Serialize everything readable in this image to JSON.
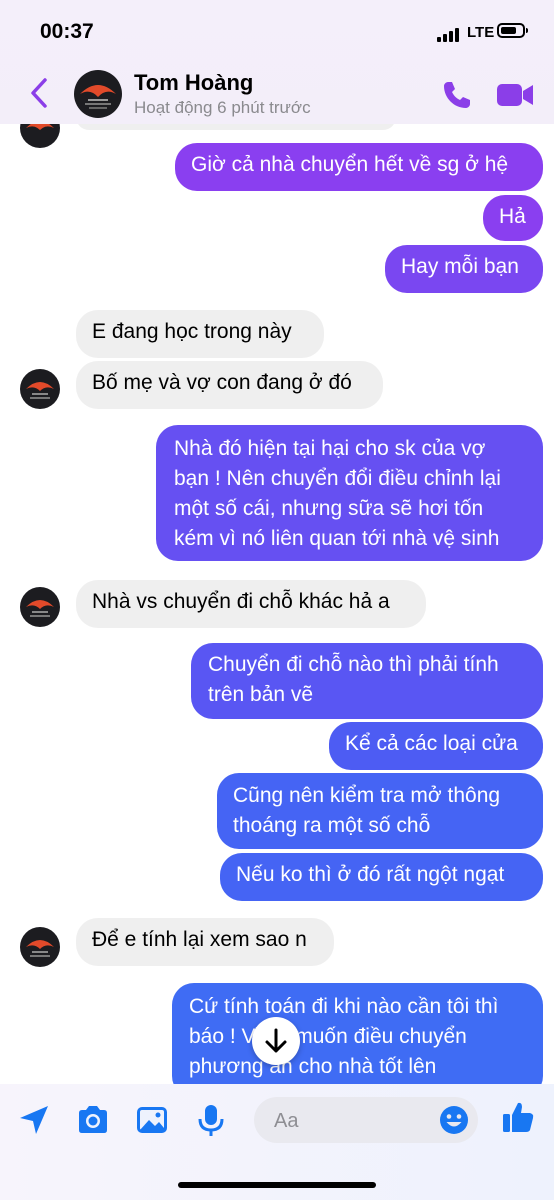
{
  "status_bar": {
    "time": "00:37",
    "network": "LTE",
    "battery_level": 0.75
  },
  "header": {
    "contact_name": "Tom Hoàng",
    "contact_status": "Hoạt động 6 phút trước",
    "icons": {
      "back": "chevron-left-icon",
      "call": "phone-icon",
      "video": "video-camera-icon"
    },
    "accent_color": "#8b3ee8"
  },
  "messages": [
    {
      "from": "me",
      "lines": [
        "Giờ cả nhà chuyển hết về sg ở hệ"
      ]
    },
    {
      "from": "me",
      "lines": [
        "Hả"
      ]
    },
    {
      "from": "me",
      "lines": [
        "Hay mỗi bạn"
      ]
    },
    {
      "from": "them",
      "lines": [
        "E đang học trong này"
      ]
    },
    {
      "from": "them",
      "lines": [
        "Bố mẹ và vợ con đang ở đó"
      ]
    },
    {
      "from": "me",
      "lines": [
        "Nhà đó hiện tại hại cho sk của vợ",
        "bạn ! Nên chuyển đổi điều chỉnh lại",
        "một số cái, nhưng sữa sẽ hơi tốn",
        "kém vì nó liên quan tới nhà vệ sinh"
      ]
    },
    {
      "from": "them",
      "lines": [
        "Nhà vs chuyển đi chỗ khác hả a"
      ]
    },
    {
      "from": "me",
      "lines": [
        "Chuyển đi chỗ nào thì phải tính",
        "trên bản vẽ"
      ]
    },
    {
      "from": "me",
      "lines": [
        "Kể cả các loại cửa"
      ]
    },
    {
      "from": "me",
      "lines": [
        "Cũng nên kiểm tra mở thông",
        "thoáng ra một số chỗ"
      ]
    },
    {
      "from": "me",
      "lines": [
        "Nếu ko thì ở đó rất ngột ngạt"
      ]
    },
    {
      "from": "them",
      "lines": [
        "Để e tính lại xem sao n"
      ]
    },
    {
      "from": "me",
      "lines": [
        "Cứ tính toán đi khi nào cần tôi thì",
        "báo ! Vì tôi muốn điều chuyển",
        "phương án cho nhà tốt lên"
      ]
    }
  ],
  "composer": {
    "placeholder": "Aa",
    "icons": [
      "send-location-icon",
      "camera-icon",
      "gallery-icon",
      "microphone-icon",
      "emoji-icon",
      "thumbs-up-icon"
    ],
    "accent_color": "#1877f2"
  },
  "scroll_button_icon": "arrow-down-icon"
}
